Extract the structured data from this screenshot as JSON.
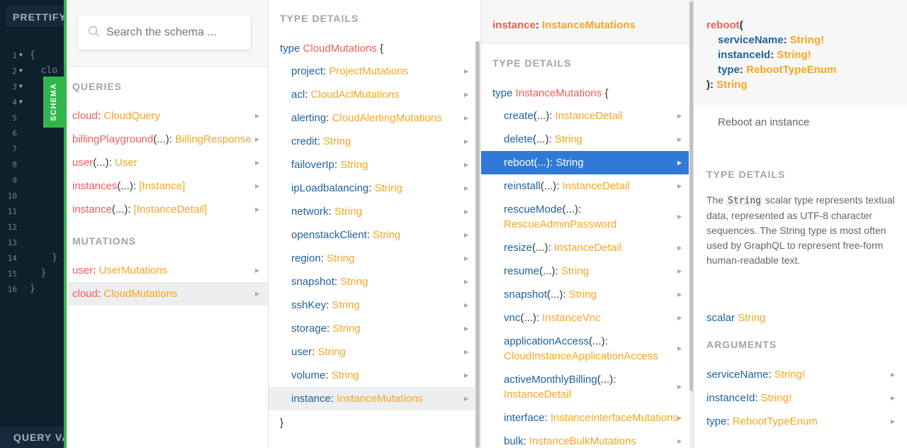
{
  "editor": {
    "prettify_label": "PRETTIFY",
    "query_vars_label": "QUERY VA",
    "lines": [
      {
        "num": "1",
        "fold": "▼",
        "code": "{"
      },
      {
        "num": "2",
        "fold": "▼",
        "code": "  clo"
      },
      {
        "num": "3",
        "fold": "▼",
        "code": ""
      },
      {
        "num": "4",
        "fold": "▼",
        "code": ""
      },
      {
        "num": "5",
        "fold": "",
        "code": ""
      },
      {
        "num": "6",
        "fold": "",
        "code": ""
      },
      {
        "num": "7",
        "fold": "",
        "code": ""
      },
      {
        "num": "8",
        "fold": "",
        "code": ""
      },
      {
        "num": "9",
        "fold": "",
        "code": ""
      },
      {
        "num": "10",
        "fold": "",
        "code": ""
      },
      {
        "num": "11",
        "fold": "",
        "code": ""
      },
      {
        "num": "12",
        "fold": "",
        "code": ""
      },
      {
        "num": "13",
        "fold": "",
        "code": ""
      },
      {
        "num": "14",
        "fold": "",
        "code": "    }"
      },
      {
        "num": "15",
        "fold": "",
        "code": "  }"
      },
      {
        "num": "16",
        "fold": "",
        "code": "}"
      }
    ]
  },
  "schema_tab": "SCHEMA",
  "search": {
    "placeholder": "Search the schema ..."
  },
  "col1": {
    "queries_title": "QUERIES",
    "queries": [
      {
        "name": "cloud",
        "args": "",
        "type": "CloudQuery"
      },
      {
        "name": "billingPlayground",
        "args": "(...)",
        "type": "BillingResponse"
      },
      {
        "name": "user",
        "args": "(...)",
        "type": "User"
      },
      {
        "name": "instances",
        "args": "(...)",
        "type": "[Instance]"
      },
      {
        "name": "instance",
        "args": "(...)",
        "type": "[InstanceDetail]"
      }
    ],
    "mutations_title": "MUTATIONS",
    "mutations": [
      {
        "name": "user",
        "args": "",
        "type": "UserMutations"
      },
      {
        "name": "cloud",
        "args": "",
        "type": "CloudMutations"
      }
    ]
  },
  "col2": {
    "title": "TYPE DETAILS",
    "type_keyword": "type",
    "type_name": "CloudMutations",
    "open_brace": "{",
    "close_brace": "}",
    "fields": [
      {
        "name": "project",
        "type": "ProjectMutations"
      },
      {
        "name": "acl",
        "type": "CloudAclMutations"
      },
      {
        "name": "alerting",
        "type": "CloudAlertingMutations"
      },
      {
        "name": "credit",
        "type": "String"
      },
      {
        "name": "failoverIp",
        "type": "String"
      },
      {
        "name": "ipLoadbalancing",
        "type": "String"
      },
      {
        "name": "network",
        "type": "String"
      },
      {
        "name": "openstackClient",
        "type": "String"
      },
      {
        "name": "region",
        "type": "String"
      },
      {
        "name": "snapshot",
        "type": "String"
      },
      {
        "name": "sshKey",
        "type": "String"
      },
      {
        "name": "storage",
        "type": "String"
      },
      {
        "name": "user",
        "type": "String"
      },
      {
        "name": "volume",
        "type": "String"
      },
      {
        "name": "instance",
        "type": "InstanceMutations"
      }
    ]
  },
  "col3": {
    "header_name": "instance",
    "header_type": "InstanceMutations",
    "title": "TYPE DETAILS",
    "type_keyword": "type",
    "type_name": "InstanceMutations",
    "open_brace": "{",
    "fields": [
      {
        "name": "create",
        "args": "(...)",
        "type": "InstanceDetail",
        "wrap": false
      },
      {
        "name": "delete",
        "args": "(...)",
        "type": "String",
        "wrap": false
      },
      {
        "name": "reboot",
        "args": "(...)",
        "type": "String",
        "wrap": false
      },
      {
        "name": "reinstall",
        "args": "(...)",
        "type": "InstanceDetail",
        "wrap": false
      },
      {
        "name": "rescueMode",
        "args": "(...)",
        "type": "RescueAdminPassword",
        "wrap": true
      },
      {
        "name": "resize",
        "args": "(...)",
        "type": "InstanceDetail",
        "wrap": false
      },
      {
        "name": "resume",
        "args": "(...)",
        "type": "String",
        "wrap": false
      },
      {
        "name": "snapshot",
        "args": "(...)",
        "type": "String",
        "wrap": false
      },
      {
        "name": "vnc",
        "args": "(...)",
        "type": "InstanceVnc",
        "wrap": false
      },
      {
        "name": "applicationAccess",
        "args": "(...)",
        "type": "CloudInstanceApplicationAccess",
        "wrap": true
      },
      {
        "name": "activeMonthlyBilling",
        "args": "(...)",
        "type": "InstanceDetail",
        "wrap": true
      },
      {
        "name": "interface",
        "args": "",
        "type": "InstanceInterfaceMutations",
        "wrap": false
      },
      {
        "name": "bulk",
        "args": "",
        "type": "InstanceBulkMutations",
        "wrap": false
      }
    ]
  },
  "col4": {
    "sig_name": "reboot",
    "sig_open": "(",
    "sig_args": [
      {
        "name": "serviceName",
        "type": "String!"
      },
      {
        "name": "instanceId",
        "type": "String!"
      },
      {
        "name": "type",
        "type": "RebootTypeEnum"
      }
    ],
    "sig_close": ")",
    "sig_return": "String",
    "description": "Reboot an instance",
    "type_details_title": "TYPE DETAILS",
    "desc_pre": "The",
    "desc_code": "String",
    "desc_post": "scalar type represents textual data, represented as UTF-8 character sequences. The String type is most often used by GraphQL to represent free-form human-readable text.",
    "scalar_keyword": "scalar",
    "scalar_name": "String",
    "arguments_title": "ARGUMENTS",
    "arguments": [
      {
        "name": "serviceName",
        "type": "String!"
      },
      {
        "name": "instanceId",
        "type": "String!"
      },
      {
        "name": "type",
        "type": "RebootTypeEnum"
      }
    ]
  },
  "colors": {
    "field": "#1f61a0",
    "type": "#f5a623",
    "query": "#f25c54",
    "selected": "#2f7ad6",
    "schema_tab": "#31b64c",
    "editor_bg": "#0f202d"
  }
}
